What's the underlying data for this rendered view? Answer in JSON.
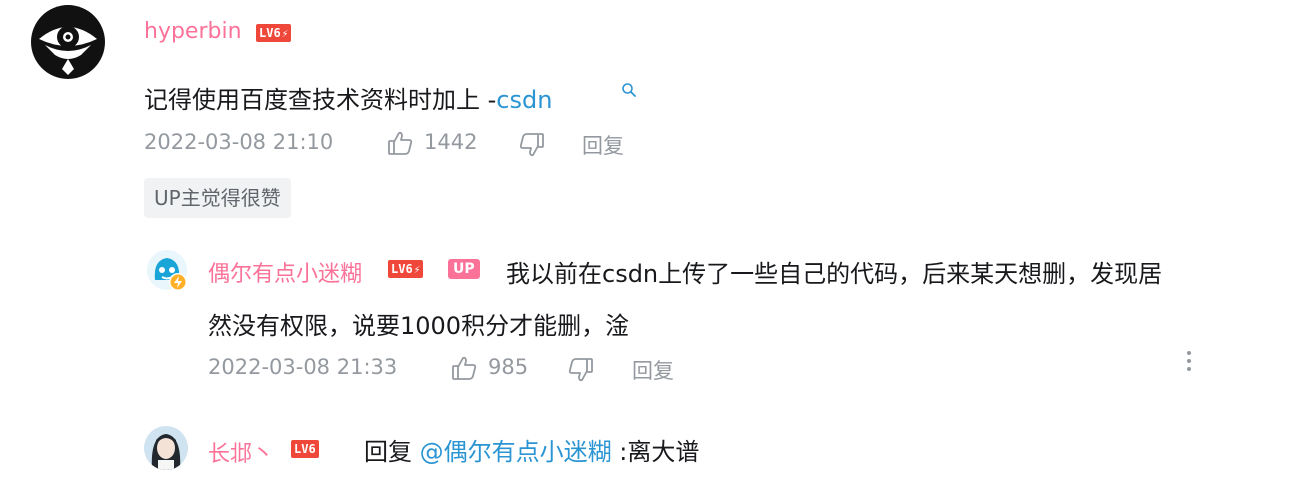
{
  "comment": {
    "username": "hyperbin",
    "level": "LV6",
    "text": "记得使用百度查技术资料时加上 -",
    "link": "csdn",
    "date": "2022-03-08 21:10",
    "likes": "1442",
    "reply_label": "回复",
    "tag": "UP主觉得很赞"
  },
  "reply1": {
    "username": "偶尔有点小迷糊",
    "level": "LV6",
    "up_badge": "UP",
    "text_line1": "我以前在csdn上传了一些自己的代码，后来某天想删，发现居",
    "text_line2": "然没有权限，说要1000积分才能删，淦",
    "date": "2022-03-08 21:33",
    "likes": "985",
    "reply_label": "回复"
  },
  "reply2": {
    "username": "长邶丶",
    "level": "LV6",
    "reply_prefix": "回复",
    "mention": "@偶尔有点小迷糊",
    "text": " :离大谱"
  },
  "colors": {
    "username": "#fb7299",
    "link": "#2b95d3",
    "meta": "#9499a0",
    "level_badge": "#f0473b"
  },
  "icons": [
    "eye-avatar",
    "level-bolt-icon",
    "search-icon",
    "thumb-up-icon",
    "thumb-down-icon",
    "more-vertical-icon",
    "verified-bolt-icon"
  ]
}
